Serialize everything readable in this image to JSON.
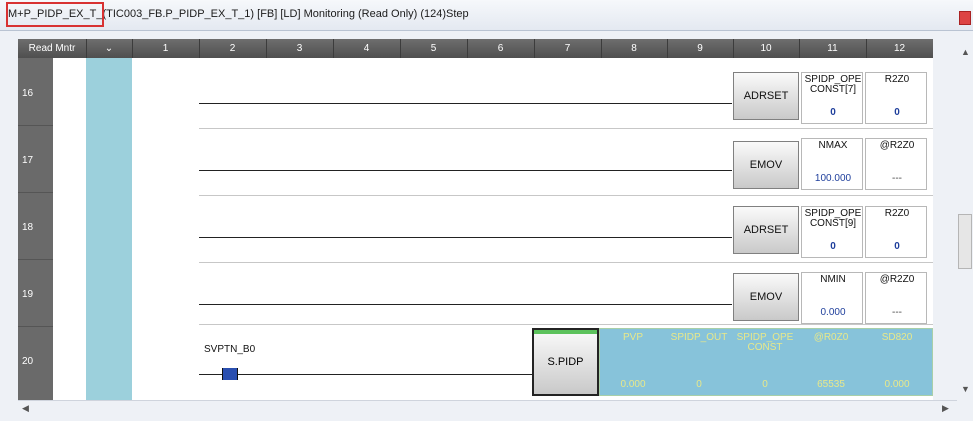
{
  "window": {
    "title": "M+P_PIDP_EX_T_(TIC003_FB.P_PIDP_EX_T_1) [FB] [LD] Monitoring (Read Only) (124)Step"
  },
  "header": {
    "mode_label": "Read Mntr",
    "dropdown_glyph": "⌄",
    "columns": [
      "1",
      "2",
      "3",
      "4",
      "5",
      "6",
      "7",
      "8",
      "9",
      "10",
      "11",
      "12"
    ]
  },
  "rows": [
    "16",
    "17",
    "18",
    "19",
    "20"
  ],
  "rungs": [
    {
      "fb": "ADRSET",
      "op_name": "SPIDP_OPE\nCONST[7]",
      "op_value": "0",
      "dest_name": "R2Z0",
      "dest_value": "0"
    },
    {
      "fb": "EMOV",
      "op_name": "NMAX",
      "op_value": "100.000",
      "dest_name": "@R2Z0",
      "dest_value": "---"
    },
    {
      "fb": "ADRSET",
      "op_name": "SPIDP_OPE\nCONST[9]",
      "op_value": "0",
      "dest_name": "R2Z0",
      "dest_value": "0"
    },
    {
      "fb": "EMOV",
      "op_name": "NMIN",
      "op_value": "0.000",
      "dest_name": "@R2Z0",
      "dest_value": "---"
    }
  ],
  "rung20": {
    "contact_label": "SVPTN_B0",
    "fb": "S.PIDP",
    "operands": [
      {
        "name": "PVP",
        "value": "0.000"
      },
      {
        "name": "SPIDP_OUT",
        "value": "0"
      },
      {
        "name": "SPIDP_OPE\nCONST",
        "value": "0"
      },
      {
        "name": "@R0Z0",
        "value": "65535"
      },
      {
        "name": "SD820",
        "value": "0.000"
      }
    ]
  },
  "colors": {
    "highlight_box": "#d83232",
    "row_label_bg": "#6a6a6a",
    "column_b_bg": "#9cd0dc",
    "selection_bg": "#87c3da",
    "contact_on": "#2a4fb0"
  }
}
